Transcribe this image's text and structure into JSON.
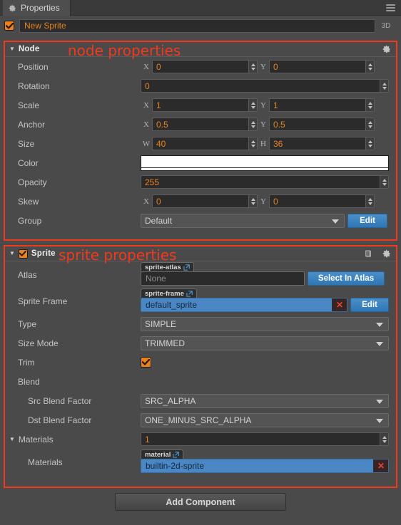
{
  "window": {
    "tab_title": "Properties",
    "tab_icon": "gear-icon",
    "menu_icon": "hamburger-menu-icon"
  },
  "name_row": {
    "enabled": true,
    "node_name": "New Sprite",
    "mode_label": "3D"
  },
  "annotations": {
    "node": "node properties",
    "sprite": "sprite properties",
    "color": "#f2391d"
  },
  "node_section": {
    "title": "Node",
    "expanded": true,
    "gear_icon": "gear-icon",
    "rows": {
      "position": {
        "label": "Position",
        "x_axis": "X",
        "x": "0",
        "y_axis": "Y",
        "y": "0"
      },
      "rotation": {
        "label": "Rotation",
        "value": "0"
      },
      "scale": {
        "label": "Scale",
        "x_axis": "X",
        "x": "1",
        "y_axis": "Y",
        "y": "1"
      },
      "anchor": {
        "label": "Anchor",
        "x_axis": "X",
        "x": "0.5",
        "y_axis": "Y",
        "y": "0.5"
      },
      "size": {
        "label": "Size",
        "w_axis": "W",
        "w": "40",
        "h_axis": "H",
        "h": "36"
      },
      "color": {
        "label": "Color",
        "swatch": "#ffffff",
        "alpha_swatch": "#ffffff"
      },
      "opacity": {
        "label": "Opacity",
        "value": "255"
      },
      "skew": {
        "label": "Skew",
        "x_axis": "X",
        "x": "0",
        "y_axis": "Y",
        "y": "0"
      },
      "group": {
        "label": "Group",
        "value": "Default",
        "edit_label": "Edit"
      }
    }
  },
  "sprite_section": {
    "title": "Sprite",
    "enabled": true,
    "expanded": true,
    "help_icon": "book-icon",
    "gear_icon": "gear-icon",
    "rows": {
      "atlas": {
        "label": "Atlas",
        "chip": "sprite-atlas",
        "chip_icon": "external-link-icon",
        "value": "None",
        "button_label": "Select In Atlas"
      },
      "sprite_frame": {
        "label": "Sprite Frame",
        "chip": "sprite-frame",
        "chip_icon": "external-link-icon",
        "value": "default_sprite",
        "clear_icon": "clear-x-icon",
        "edit_label": "Edit"
      },
      "type": {
        "label": "Type",
        "value": "SIMPLE"
      },
      "size_mode": {
        "label": "Size Mode",
        "value": "TRIMMED"
      },
      "trim": {
        "label": "Trim",
        "checked": true
      },
      "blend": {
        "label": "Blend"
      },
      "src_blend": {
        "label": "Src Blend Factor",
        "value": "SRC_ALPHA"
      },
      "dst_blend": {
        "label": "Dst Blend Factor",
        "value": "ONE_MINUS_SRC_ALPHA"
      },
      "materials_count": {
        "label": "Materials",
        "value": "1",
        "expanded": true
      },
      "materials_item": {
        "label": "Materials",
        "chip": "material",
        "chip_icon": "external-link-icon",
        "value": "builtin-2d-sprite",
        "clear_icon": "clear-x-icon"
      }
    }
  },
  "footer": {
    "add_component_label": "Add Component"
  }
}
